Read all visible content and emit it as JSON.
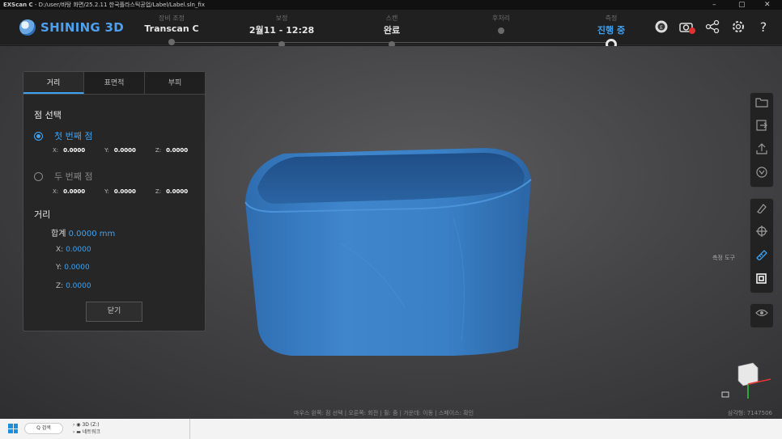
{
  "window": {
    "title_app": "EXScan C",
    "title_path": " - D:/user/바탕 화면/25.2.11 한국플라스틱공업/Label/Label.sln_fix",
    "minimize": "–",
    "maximize": "▢",
    "close": "✕"
  },
  "logo": {
    "text": "SHINING 3D"
  },
  "steps": [
    {
      "label": "장비 조정",
      "value": "Transcan C"
    },
    {
      "label": "보정",
      "value": "2월11 - 12:28"
    },
    {
      "label": "스캔",
      "value": "완료"
    },
    {
      "label": "후처리",
      "value": ""
    },
    {
      "label": "측정",
      "value": "진행 중"
    }
  ],
  "top_icons": [
    "globe-icon",
    "screenshot-icon",
    "share-icon",
    "settings-icon",
    "help-icon"
  ],
  "panel": {
    "tabs": [
      "거리",
      "표면적",
      "부피"
    ],
    "point_select_title": "점 선택",
    "first_point": {
      "label": "첫 번째 점",
      "x": "0.0000",
      "y": "0.0000",
      "z": "0.0000"
    },
    "second_point": {
      "label": "두 번째 점",
      "x": "0.0000",
      "y": "0.0000",
      "z": "0.0000"
    },
    "coord_keys": {
      "x": "X:",
      "y": "Y:",
      "z": "Z:"
    },
    "distance_title": "거리",
    "total_label": "합계",
    "total_value": "0.0000 mm",
    "dx": "0.0000",
    "dy": "0.0000",
    "dz": "0.0000",
    "close_label": "닫기"
  },
  "right_toolbar": {
    "tool_label": "측정 도구"
  },
  "status": {
    "hint": "마우스 왼쪽: 점 선택 | 오른쪽: 회전 | 휠: 줌 | 가운데: 이동 | 스페이스: 확인",
    "point_count": "삼각형: 7147506"
  },
  "taskbar": {
    "search": "Q 검색",
    "tree_items": [
      "3D (Z:)",
      "네트워크"
    ]
  },
  "colors": {
    "accent": "#3ea2f2",
    "model": "#3a7fc4"
  }
}
